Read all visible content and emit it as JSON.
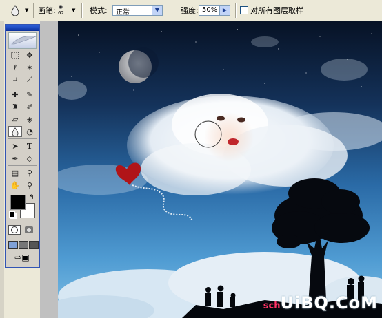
{
  "options": {
    "brush_label": "画笔:",
    "brush_size": "62",
    "mode_label": "模式:",
    "mode_value": "正常",
    "strength_label": "强度:",
    "strength_value": "50%",
    "sample_all_label": "对所有图层取样"
  },
  "toolbox": {
    "icons": [
      "marquee",
      "move",
      "lasso",
      "magic-wand",
      "crop",
      "slice",
      "healing",
      "brush",
      "stamp",
      "history-brush",
      "eraser",
      "gradient",
      "blur",
      "dodge",
      "path-select",
      "type",
      "pen",
      "shape",
      "notes",
      "eyedropper",
      "hand",
      "zoom"
    ],
    "selected": "blur",
    "foreground": "#000000",
    "background": "#ffffff"
  },
  "watermark": {
    "prefix": "sch",
    "main": "UiBQ.CoM",
    "color": "#ffffff",
    "prefix_color": "#ff3366"
  }
}
